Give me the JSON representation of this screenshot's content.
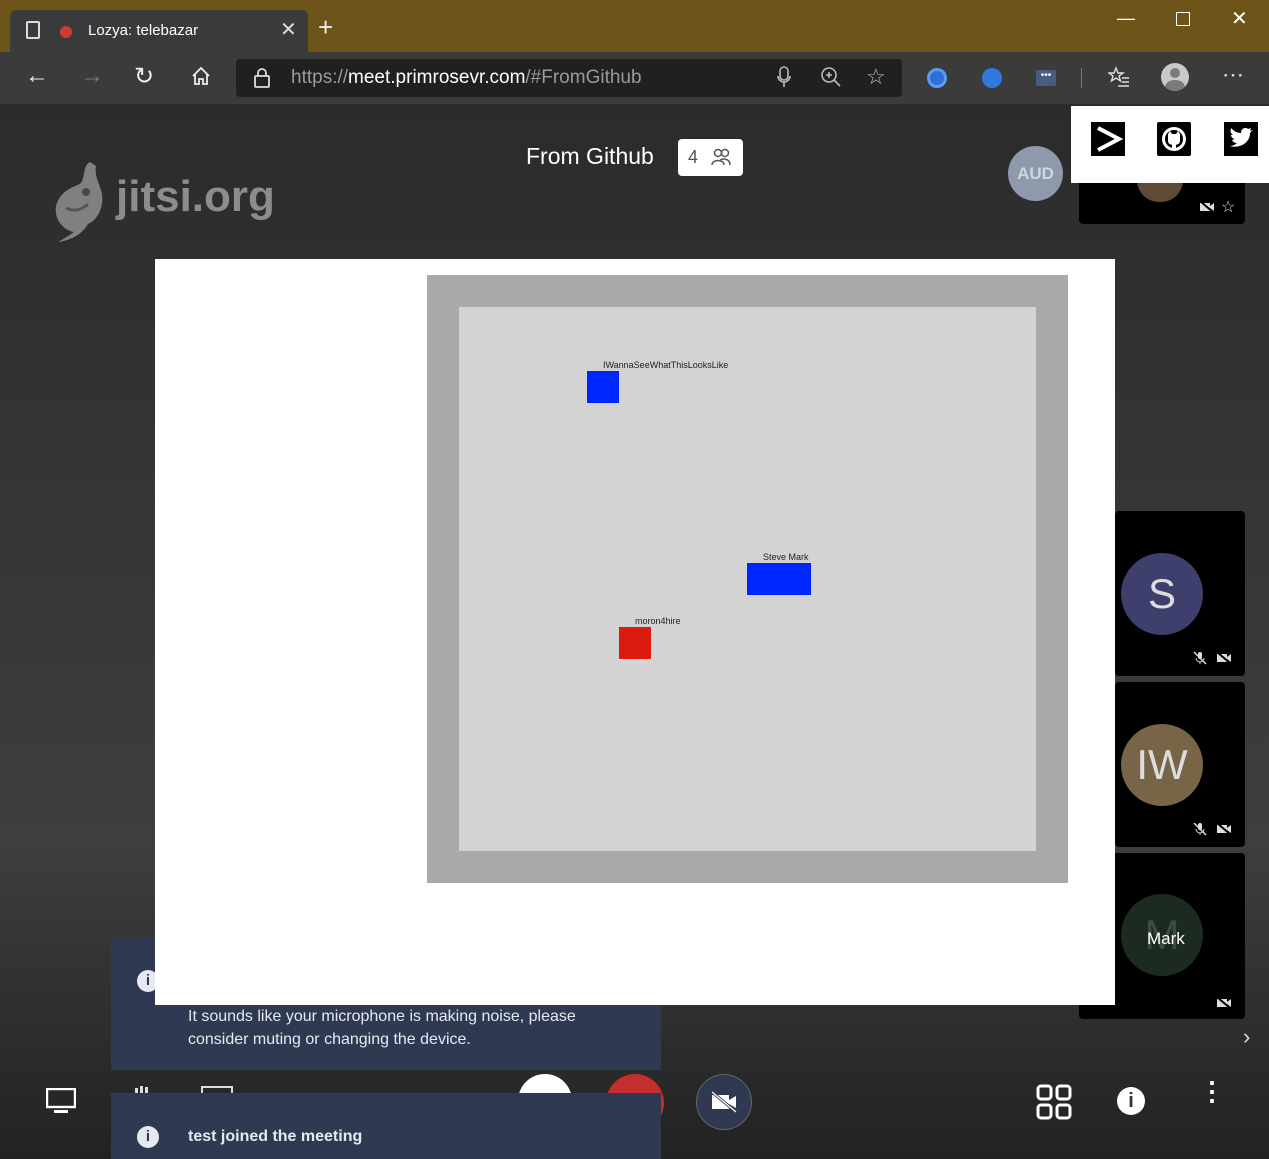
{
  "browser": {
    "tab_title": "Lozya: telebazar",
    "url_scheme": "https://",
    "url_host": "meet.primrosevr.com",
    "url_path": "/#FromGithub",
    "new_tab_label": "+"
  },
  "meeting": {
    "logo_text": "jitsi.org",
    "title": "From Github",
    "participant_count": "4",
    "aud_label": "AUD"
  },
  "arena": {
    "avatars": [
      {
        "label": "IWannaSeeWhatThisLooksLike",
        "color": "#0026ff"
      },
      {
        "label": "Steve  Mark",
        "color": "#0026ff"
      },
      {
        "label": "moron4hire",
        "color": "#dd1a12"
      }
    ]
  },
  "participants": {
    "thumbs": [
      {
        "initials": "S",
        "color": "#3f3f6e"
      },
      {
        "initials": "IW",
        "color": "#786548"
      }
    ],
    "mark": {
      "initials": "M",
      "name": "Mark"
    }
  },
  "notifications": {
    "noise_text": "It sounds like your microphone is making noise, please consider muting or changing the device.",
    "joined_text": "test joined the meeting"
  },
  "colors": {
    "titlebar": "#6d5418",
    "notification_bg": "#2f3a52"
  }
}
